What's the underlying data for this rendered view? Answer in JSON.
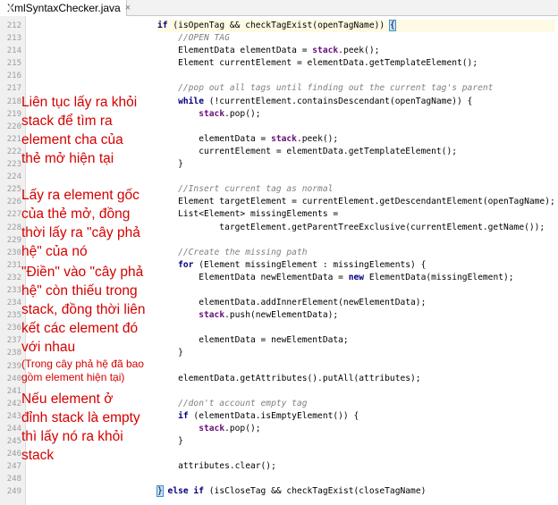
{
  "tab": {
    "label": "XmlSyntaxChecker.java",
    "close": "×",
    "icon": "java-class-icon"
  },
  "colors": {
    "annotation": "#d40000",
    "comment": "#808080",
    "keyword": "#000080",
    "field": "#660e7a"
  },
  "line_numbers": [
    "212",
    "213",
    "214",
    "215",
    "216",
    "217",
    "218",
    "219",
    "220",
    "221",
    "222",
    "223",
    "224",
    "225",
    "226",
    "227",
    "228",
    "229",
    "230",
    "231",
    "232",
    "233",
    "234",
    "235",
    "236",
    "237",
    "238",
    "239",
    "240",
    "241",
    "242",
    "243",
    "244",
    "245",
    "246",
    "247",
    "248",
    "249"
  ],
  "code": {
    "l212_a": "if",
    "l212_b": " (isOpenTag && checkTagExist(openTagName)) ",
    "l212_c": "{",
    "l213": "    //OPEN TAG",
    "l214_a": "    ElementData elementData = ",
    "l214_b": "stack",
    "l214_c": ".peek();",
    "l215": "    Element currentElement = elementData.getTemplateElement();",
    "l217": "    //pop out all tags until finding out the current tag's parent",
    "l218_a": "    while",
    "l218_b": " (!currentElement.containsDescendant(openTagName)) {",
    "l219_a": "        ",
    "l219_b": "stack",
    "l219_c": ".pop();",
    "l221_a": "        elementData = ",
    "l221_b": "stack",
    "l221_c": ".peek();",
    "l222": "        currentElement = elementData.getTemplateElement();",
    "l223": "    }",
    "l225": "    //Insert current tag as normal",
    "l226": "    Element targetElement = currentElement.getDescendantElement(openTagName);",
    "l227": "    List<Element> missingElements =",
    "l228": "            targetElement.getParentTreeExclusive(currentElement.getName());",
    "l230": "    //Create the missing path",
    "l231_a": "    for",
    "l231_b": " (Element missingElement : missingElements) {",
    "l232_a": "        ElementData newElementData = ",
    "l232_b": "new",
    "l232_c": " ElementData(missingElement);",
    "l234": "        elementData.addInnerElement(newElementData);",
    "l235_a": "        ",
    "l235_b": "stack",
    "l235_c": ".push(newElementData);",
    "l237": "        elementData = newElementData;",
    "l238": "    }",
    "l240": "    elementData.getAttributes().putAll(attributes);",
    "l242": "    //don't account empty tag",
    "l243_a": "    if",
    "l243_b": " (elementData.isEmptyElement()) {",
    "l244_a": "        ",
    "l244_b": "stack",
    "l244_c": ".pop();",
    "l245": "    }",
    "l247": "    attributes.clear();",
    "l249_a": "}",
    "l249_b": " else if",
    "l249_c": " (isCloseTag && checkTagExist(closeTagName)"
  },
  "annotations": {
    "note1": [
      "Liên tục lấy ra khỏi",
      "stack để tìm ra",
      "element cha của",
      "thẻ mở hiện tại"
    ],
    "note2": [
      "Lấy ra element gốc",
      "của thẻ mở, đồng",
      "thời lấy ra \"cây phả",
      "hệ\" của nó"
    ],
    "note3": [
      "\"Điền\" vào \"cây phả",
      "hệ\" còn thiếu trong",
      "stack, đồng thời liên",
      "kết các element đó",
      "với nhau"
    ],
    "note3_small": [
      "(Trong cây phả hệ đã bao",
      "gồm element hiện tại)"
    ],
    "note4": [
      "Nếu element ở",
      "đỉnh stack là empty",
      "thì lấy nó ra khỏi",
      "stack"
    ]
  }
}
